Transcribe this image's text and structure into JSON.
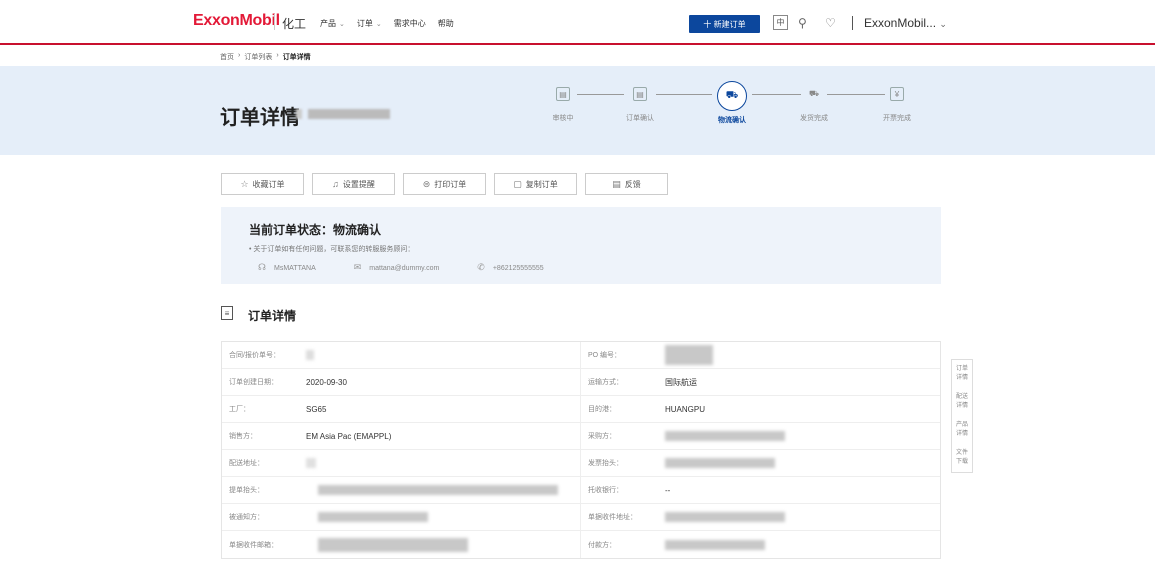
{
  "header": {
    "logo": "ExxonMobil",
    "brand": "化工",
    "nav": [
      {
        "label": "产品",
        "has_menu": true
      },
      {
        "label": "订单",
        "has_menu": true
      },
      {
        "label": "需求中心",
        "has_menu": false
      },
      {
        "label": "帮助",
        "has_menu": false
      }
    ],
    "new_order": "十 新建订单",
    "lang": "中",
    "account": "ExxonMobil..."
  },
  "breadcrumb": [
    "首页",
    "订单列表",
    "订单详情"
  ],
  "page_title": "订单详情",
  "progress": {
    "steps": [
      "审核中",
      "订单确认",
      "物流确认",
      "发货完成",
      "开票完成"
    ],
    "active_index": 2
  },
  "actions": [
    {
      "icon": "star-icon",
      "glyph": "☆",
      "label": "收藏订单"
    },
    {
      "icon": "bell-icon",
      "glyph": "♫",
      "label": "设置提醒"
    },
    {
      "icon": "print-icon",
      "glyph": "⊜",
      "label": "打印订单"
    },
    {
      "icon": "copy-icon",
      "glyph": "▢",
      "label": "复制订单"
    },
    {
      "icon": "feedback-icon",
      "glyph": "▤",
      "label": "反馈"
    }
  ],
  "status": {
    "title": "当前订单状态：物流确认",
    "note": "•  关于订单如有任何问题，可联系您的转服服务顾问：",
    "contact_name": "MsMATTANA",
    "contact_email": "mattana@dummy.com",
    "contact_phone": "+862125555555"
  },
  "details_title": "订单详情",
  "details": {
    "contract_no": {
      "label": "合同/报价单号：",
      "value": ""
    },
    "po_no": {
      "label": "PO 编号：",
      "value": ""
    },
    "created_date": {
      "label": "订单创建日期：",
      "value": "2020-09-30"
    },
    "shipping_method": {
      "label": "运输方式：",
      "value": "国际航运"
    },
    "plant": {
      "label": "工厂：",
      "value": "SG65"
    },
    "destination": {
      "label": "目的港：",
      "value": "HUANGPU"
    },
    "seller": {
      "label": "销售方：",
      "value": "EM Asia Pac (EMAPPL)"
    },
    "buyer": {
      "label": "采购方：",
      "value": ""
    },
    "delivery_address": {
      "label": "配送地址：",
      "value": ""
    },
    "invoice_header": {
      "label": "发票抬头：",
      "value": ""
    },
    "bill_header": {
      "label": "提单抬头：",
      "value": ""
    },
    "collecting_bank": {
      "label": "托收银行：",
      "value": "--"
    },
    "notify_party": {
      "label": "被通知方：",
      "value": ""
    },
    "doc_address": {
      "label": "单据收件地址：",
      "value": ""
    },
    "doc_email": {
      "label": "单据收件邮箱：",
      "value": ""
    },
    "payer": {
      "label": "付款方：",
      "value": ""
    }
  },
  "sidenav": [
    "订单详情",
    "配送详情",
    "产品详情",
    "文件下载"
  ]
}
